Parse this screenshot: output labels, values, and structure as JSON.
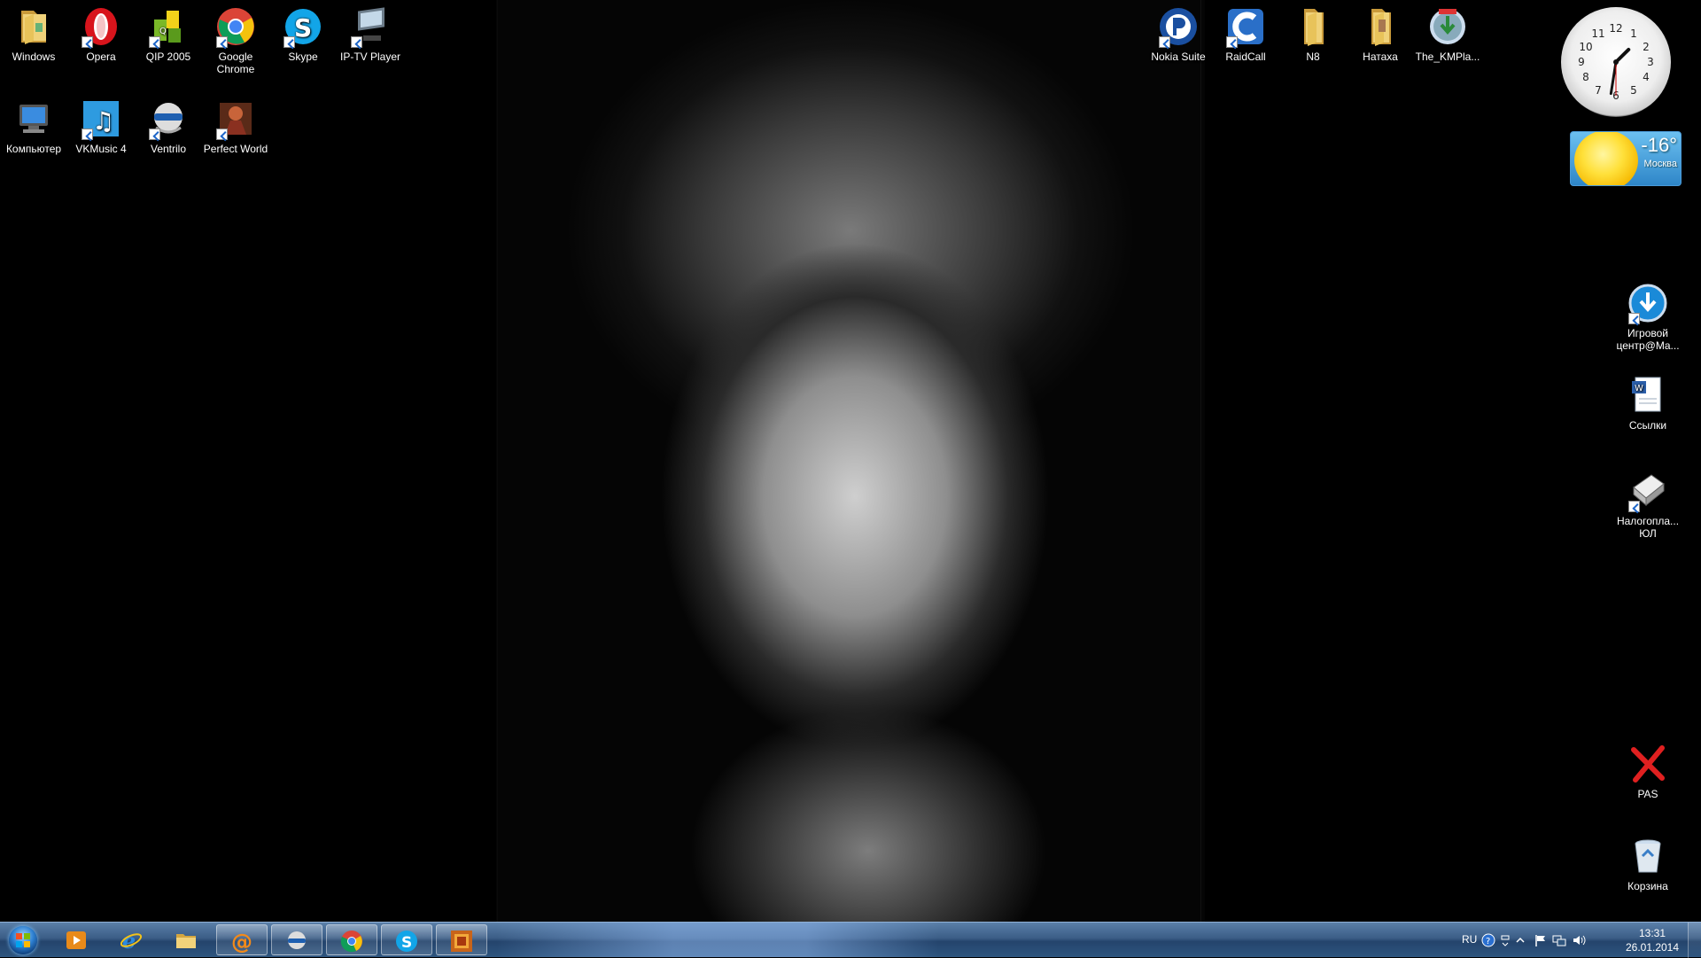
{
  "desktop": {
    "left_icons": [
      {
        "label": "Windows",
        "icon": "folder-icon"
      },
      {
        "label": "Opera",
        "icon": "opera-icon"
      },
      {
        "label": "QIP 2005",
        "icon": "qip-icon"
      },
      {
        "label": "Google Chrome",
        "icon": "chrome-icon"
      },
      {
        "label": "Skype",
        "icon": "skype-icon"
      },
      {
        "label": "IP-TV Player",
        "icon": "iptv-icon"
      },
      {
        "label": "Компьютер",
        "icon": "computer-icon"
      },
      {
        "label": "VKMusic 4",
        "icon": "vkmusic-icon"
      },
      {
        "label": "Ventrilo",
        "icon": "ventrilo-icon"
      },
      {
        "label": "Perfect World",
        "icon": "perfect-world-icon"
      }
    ],
    "top_right_icons": [
      {
        "label": "Nokia Suite",
        "icon": "nokia-suite-icon"
      },
      {
        "label": "RaidCall",
        "icon": "raidcall-icon"
      },
      {
        "label": "N8",
        "icon": "folder-icon"
      },
      {
        "label": "Натаха",
        "icon": "folder-icon"
      },
      {
        "label": "The_KMPla...",
        "icon": "kmplayer-installer-icon"
      }
    ],
    "right_icons": [
      {
        "label": "Игровой центр@Ma...",
        "icon": "game-center-icon"
      },
      {
        "label": "Ссылки",
        "icon": "document-icon"
      },
      {
        "label": "Налогопла... ЮЛ",
        "icon": "tax-app-icon"
      },
      {
        "label": "PAS",
        "icon": "red-x-icon"
      },
      {
        "label": "Корзина",
        "icon": "recycle-bin-icon"
      }
    ]
  },
  "gadgets": {
    "clock": {
      "hour": 1,
      "minute": 31,
      "second": 30
    },
    "weather": {
      "temperature": "-16°",
      "city": "Москва"
    }
  },
  "taskbar": {
    "items": [
      {
        "name": "media-player",
        "icon": "media-player-icon",
        "running": false
      },
      {
        "name": "internet-explorer",
        "icon": "ie-icon",
        "running": false
      },
      {
        "name": "explorer",
        "icon": "folder-icon",
        "running": false
      },
      {
        "name": "mail-agent",
        "icon": "mail-agent-icon",
        "running": true
      },
      {
        "name": "ventrilo",
        "icon": "ventrilo-icon",
        "running": true
      },
      {
        "name": "chrome",
        "icon": "chrome-icon",
        "running": true
      },
      {
        "name": "skype",
        "icon": "skype-icon",
        "running": true
      },
      {
        "name": "perfect-world",
        "icon": "perfect-world-icon",
        "running": true
      }
    ],
    "tray": {
      "language": "RU",
      "time": "13:31",
      "date": "26.01.2014"
    }
  },
  "colors": {
    "taskbar": "#2e557f",
    "accent": "#1e66c8"
  }
}
